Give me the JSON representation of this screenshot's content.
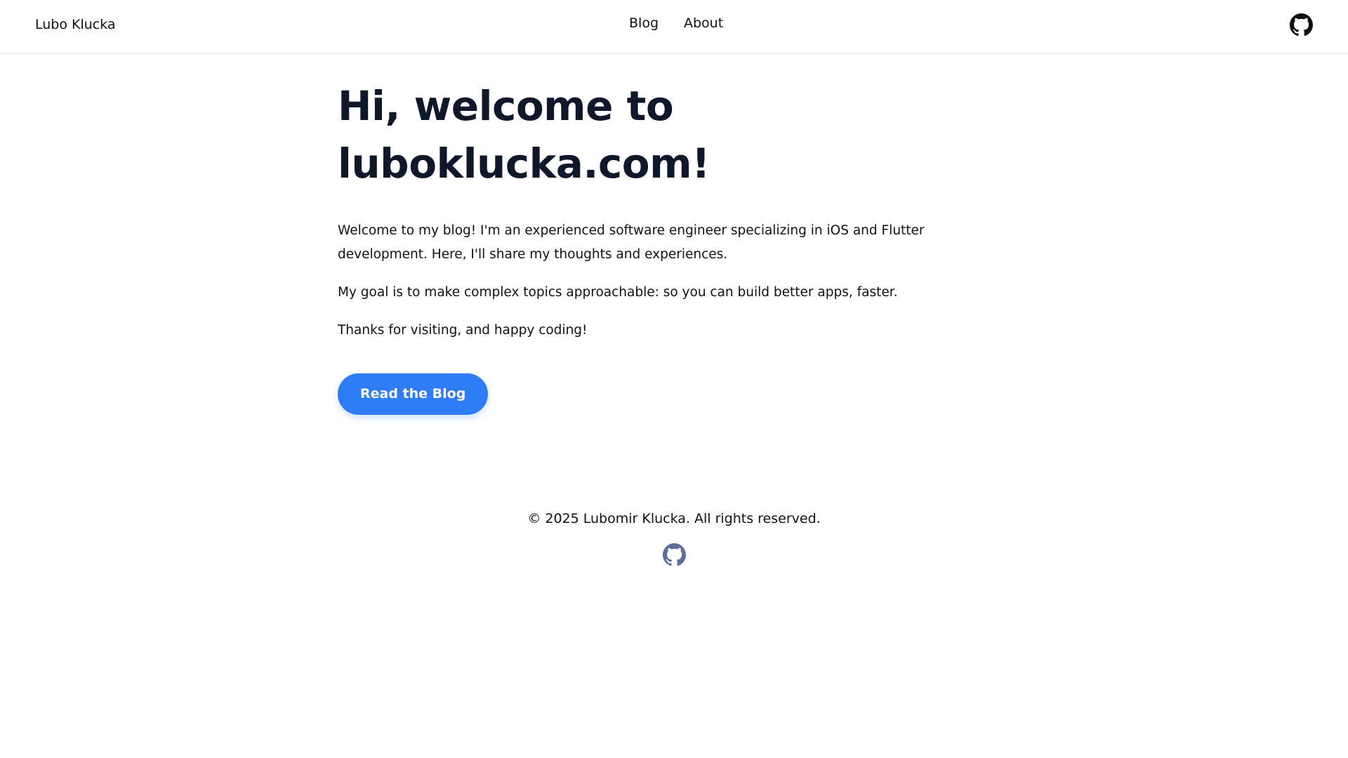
{
  "header": {
    "brand": "Lubo Klucka",
    "nav": [
      {
        "label": "Blog"
      },
      {
        "label": "About"
      }
    ],
    "github_icon": "github-icon"
  },
  "main": {
    "title": "Hi, welcome to luboklucka.com!",
    "paragraphs": [
      "Welcome to my blog! I'm an experienced software engineer specializing in iOS and Flutter development. Here, I'll share my thoughts and experiences.",
      "My goal is to make complex topics approachable: so you can build better apps, faster.",
      "Thanks for visiting, and happy coding!"
    ],
    "cta_label": "Read the Blog"
  },
  "footer": {
    "copyright": "© 2025 Lubomir Klucka. All rights reserved.",
    "github_icon": "github-icon"
  },
  "colors": {
    "accent": "#2d7cf6",
    "heading": "#0f172a",
    "footer_icon": "#5b6f9a"
  }
}
